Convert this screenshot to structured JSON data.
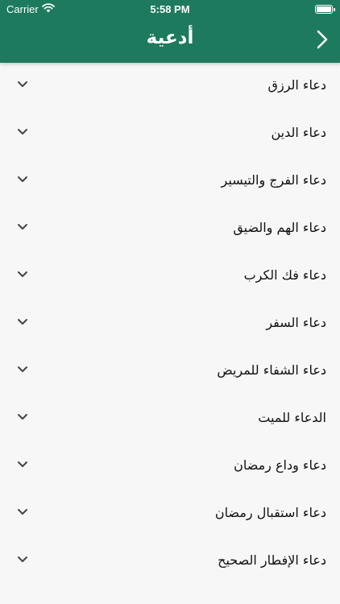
{
  "status_bar": {
    "carrier": "Carrier",
    "time": "5:58 PM"
  },
  "header": {
    "title": "أدعية",
    "back_icon": "chevron-right-icon",
    "background": "#1e7a5e"
  },
  "list": {
    "items": [
      {
        "label": "دعاء الرزق"
      },
      {
        "label": "دعاء الدين"
      },
      {
        "label": "دعاء الفرج والتيسير"
      },
      {
        "label": "دعاء الهم والضيق"
      },
      {
        "label": "دعاء فك الكرب"
      },
      {
        "label": "دعاء السفر"
      },
      {
        "label": "دعاء الشفاء للمريض"
      },
      {
        "label": "الدعاء للميت"
      },
      {
        "label": "دعاء وداع رمضان"
      },
      {
        "label": "دعاء استقبال رمضان"
      },
      {
        "label": "دعاء الإفطار الصحيح"
      }
    ],
    "expand_icon": "chevron-down-icon"
  }
}
